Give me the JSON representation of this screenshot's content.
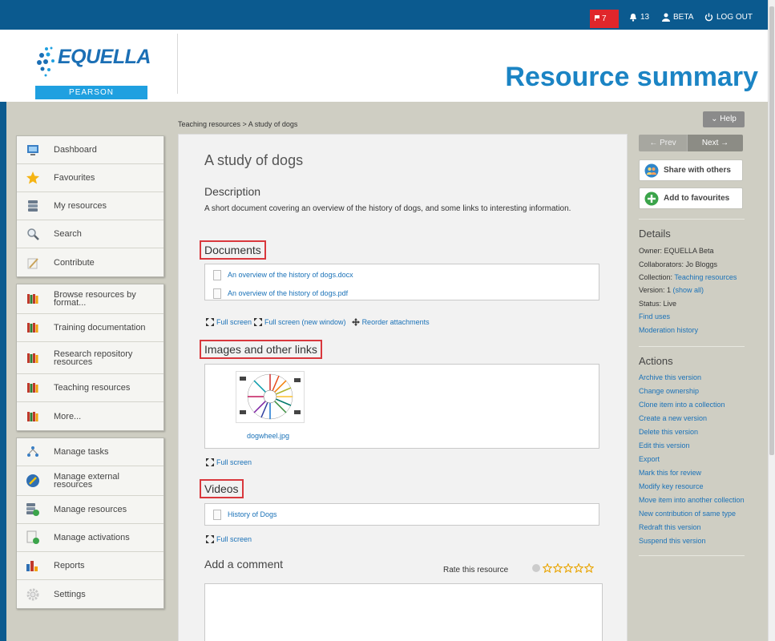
{
  "topbar": {
    "flag_count": "7",
    "notification_count": "13",
    "user": "BETA",
    "logout": "LOG OUT"
  },
  "header": {
    "logo_text": "EQUELLA",
    "logo_sub": "PEARSON",
    "title": "Resource summary"
  },
  "breadcrumb": "Teaching resources > A study of dogs",
  "help_label": "Help",
  "sidebar": {
    "group1": [
      {
        "label": "Dashboard"
      },
      {
        "label": "Favourites"
      },
      {
        "label": "My resources"
      },
      {
        "label": "Search"
      },
      {
        "label": "Contribute"
      }
    ],
    "group2": [
      {
        "label": "Browse resources by format..."
      },
      {
        "label": "Training documentation"
      },
      {
        "label": "Research repository resources"
      },
      {
        "label": "Teaching resources"
      },
      {
        "label": "More..."
      }
    ],
    "group3": [
      {
        "label": "Manage tasks"
      },
      {
        "label": "Manage external resources"
      },
      {
        "label": "Manage resources"
      },
      {
        "label": "Manage activations"
      },
      {
        "label": "Reports"
      },
      {
        "label": "Settings"
      }
    ]
  },
  "resource": {
    "title": "A study of dogs",
    "description_heading": "Description",
    "description": "A short document covering an overview of the history of dogs, and some links to interesting information.",
    "documents_heading": "Documents",
    "documents": [
      "An overview of the history of dogs.docx",
      "An overview of the history of dogs.pdf"
    ],
    "doc_actions": {
      "full_screen": "Full screen",
      "full_screen_new": "Full screen (new window)",
      "reorder": "Reorder attachments"
    },
    "images_heading": "Images and other links",
    "image_caption": "dogwheel.jpg",
    "images_full_screen": "Full screen",
    "videos_heading": "Videos",
    "videos": [
      "History of Dogs"
    ],
    "videos_full_screen": "Full screen",
    "add_comment": "Add a comment",
    "rate_label": "Rate this resource"
  },
  "right": {
    "prev": "Prev",
    "next": "Next",
    "share": "Share with others",
    "favourite": "Add to favourites",
    "details_heading": "Details",
    "owner": "Owner: EQUELLA Beta",
    "collaborators": "Collaborators: Jo Bloggs",
    "collection_label": "Collection: ",
    "collection_link": "Teaching resources",
    "version_label": "Version: 1 ",
    "version_link": "(show all)",
    "status": "Status: Live",
    "find_uses": "Find uses",
    "moderation": "Moderation history",
    "actions_heading": "Actions",
    "actions": [
      "Archive this version",
      "Change ownership",
      "Clone item into a collection",
      "Create a new version",
      "Delete this version",
      "Edit this version",
      "Export",
      "Mark this for review",
      "Modify key resource",
      "Move item into another collection",
      "New contribution of same type",
      "Redraft this version",
      "Suspend this version"
    ]
  },
  "colors": {
    "brand_blue": "#0b5a8f",
    "title_blue": "#1b84c4",
    "highlight_red": "#d9383d",
    "link": "#1b72b8"
  },
  "icons": {
    "topbar": [
      "flag-icon",
      "bell-icon",
      "user-icon",
      "power-icon"
    ],
    "sidebar": [
      "dashboard-icon",
      "star-icon",
      "stack-icon",
      "magnifier-icon",
      "pencil-paper-icon",
      "books-icon",
      "tasks-icon",
      "external-icon",
      "manage-resources-icon",
      "activation-icon",
      "bar-chart-icon",
      "gear-icon"
    ]
  }
}
